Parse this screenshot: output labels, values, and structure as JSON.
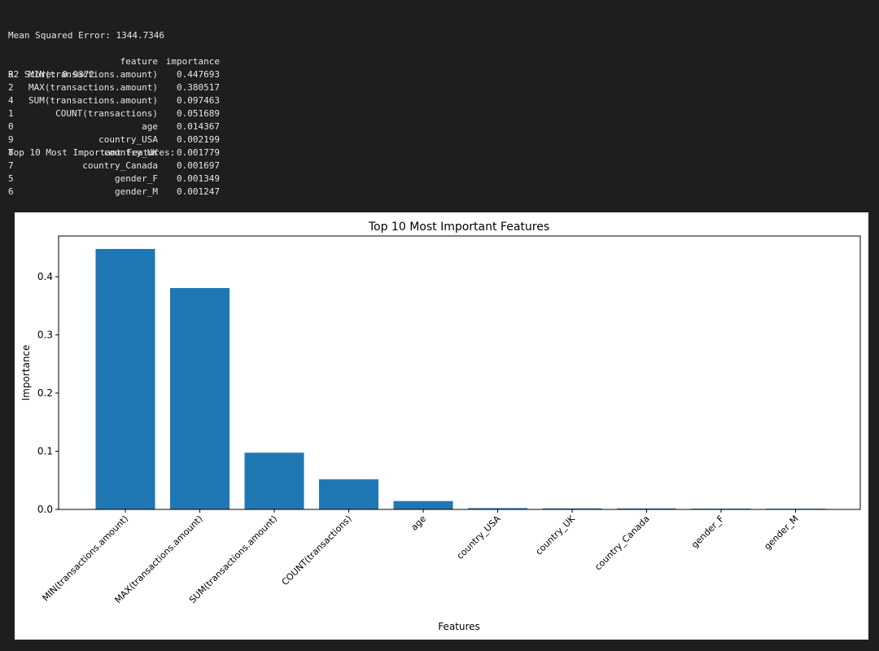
{
  "console": {
    "mse_line": "Mean Squared Error: 1344.7346",
    "r2_line": "R2 Score: 0.9372",
    "table_heading": "Top 10 Most Important Features:",
    "col_feature": "feature",
    "col_importance": "importance",
    "rows": [
      {
        "index": "3",
        "feature": "MIN(transactions.amount)",
        "importance": "0.447693"
      },
      {
        "index": "2",
        "feature": "MAX(transactions.amount)",
        "importance": "0.380517"
      },
      {
        "index": "4",
        "feature": "SUM(transactions.amount)",
        "importance": "0.097463"
      },
      {
        "index": "1",
        "feature": "COUNT(transactions)",
        "importance": "0.051689"
      },
      {
        "index": "0",
        "feature": "age",
        "importance": "0.014367"
      },
      {
        "index": "9",
        "feature": "country_USA",
        "importance": "0.002199"
      },
      {
        "index": "8",
        "feature": "country_UK",
        "importance": "0.001779"
      },
      {
        "index": "7",
        "feature": "country_Canada",
        "importance": "0.001697"
      },
      {
        "index": "5",
        "feature": "gender_F",
        "importance": "0.001349"
      },
      {
        "index": "6",
        "feature": "gender_M",
        "importance": "0.001247"
      }
    ]
  },
  "chart_data": {
    "type": "bar",
    "title": "Top 10 Most Important Features",
    "xlabel": "Features",
    "ylabel": "Importance",
    "categories": [
      "MIN(transactions.amount)",
      "MAX(transactions.amount)",
      "SUM(transactions.amount)",
      "COUNT(transactions)",
      "age",
      "country_USA",
      "country_UK",
      "country_Canada",
      "gender_F",
      "gender_M"
    ],
    "values": [
      0.447693,
      0.380517,
      0.097463,
      0.051689,
      0.014367,
      0.002199,
      0.001779,
      0.001697,
      0.001349,
      0.001247
    ],
    "yticks": [
      "0.0",
      "0.1",
      "0.2",
      "0.3",
      "0.4"
    ],
    "ylim": [
      0,
      0.47
    ],
    "bar_color": "#1f77b4",
    "grid": false,
    "x_tick_rotation": -45
  }
}
